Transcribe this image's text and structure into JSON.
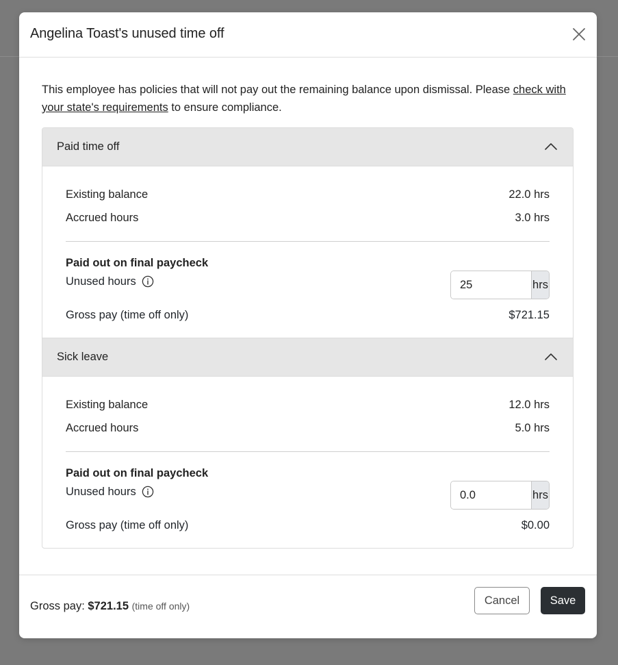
{
  "modal": {
    "title": "Angelina Toast's unused time off",
    "close_icon": "close-icon"
  },
  "notice": {
    "text_before": "This employee has policies that will not pay out the remaining balance upon dismissal. Please ",
    "link_text": "check with your state's requirements",
    "text_after": " to ensure compliance."
  },
  "sections": [
    {
      "title": "Paid time off",
      "existing_balance_label": "Existing balance",
      "existing_balance_value": "22.0 hrs",
      "accrued_label": "Accrued hours",
      "accrued_value": "3.0 hrs",
      "paid_out_title": "Paid out on final paycheck",
      "unused_label": "Unused hours",
      "unused_value": "25",
      "unit": "hrs",
      "gross_label": "Gross pay (time off only)",
      "gross_value": "$721.15"
    },
    {
      "title": "Sick leave",
      "existing_balance_label": "Existing balance",
      "existing_balance_value": "12.0 hrs",
      "accrued_label": "Accrued hours",
      "accrued_value": "5.0 hrs",
      "paid_out_title": "Paid out on final paycheck",
      "unused_label": "Unused hours",
      "unused_value": "0.0",
      "unit": "hrs",
      "gross_label": "Gross pay (time off only)",
      "gross_value": "$0.00"
    }
  ],
  "footer": {
    "gross_label": "Gross pay: ",
    "gross_amount": "$721.15",
    "gross_note": "(time off only)",
    "cancel_label": "Cancel",
    "save_label": "Save"
  },
  "colors": {
    "backdrop": "#7a7a7a",
    "section_header_bg": "#e6e6e6",
    "save_button_bg": "#2b2f33"
  }
}
